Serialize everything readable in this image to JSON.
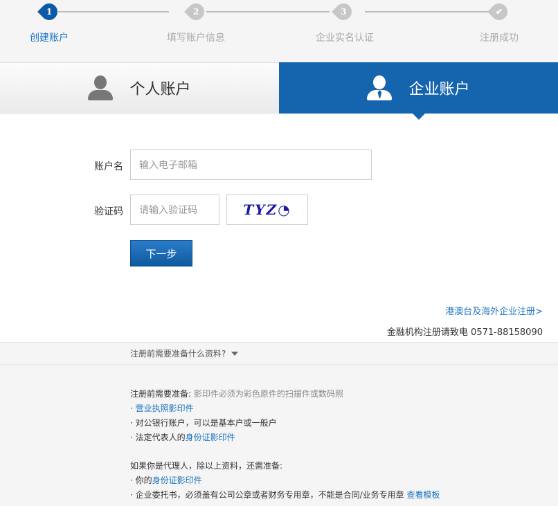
{
  "steps": [
    {
      "num": "1",
      "label": "创建账户",
      "state": "active"
    },
    {
      "num": "2",
      "label": "填写账户信息",
      "state": "inactive"
    },
    {
      "num": "3",
      "label": "企业实名认证",
      "state": "inactive"
    },
    {
      "num": "✔",
      "label": "注册成功",
      "state": "inactive"
    }
  ],
  "tabs": {
    "personal": "个人账户",
    "company": "企业账户"
  },
  "form": {
    "account_label": "账户名",
    "account_placeholder": "输入电子邮箱",
    "captcha_label": "验证码",
    "captcha_placeholder": "请输入验证码",
    "captcha_text": "TYZ◔",
    "next_button": "下一步"
  },
  "links": {
    "hk_register": "港澳台及海外企业注册>",
    "contact_prefix": "金融机构注册请致电",
    "contact_phone": "0571-88158090"
  },
  "info": {
    "toggle": "注册前需要准备什么资料?",
    "prep_title": "注册前需要准备:",
    "prep_note": "影印件必须为彩色原件的扫描件或数码照",
    "item_license": "营业执照影印件",
    "item_bank": "对公银行账户，可以是基本户或一般户",
    "item_legal_prefix": "法定代表人的",
    "item_legal_link": "身份证影印件",
    "agent_title": "如果你是代理人，除以上资料，还需准备:",
    "agent_id_prefix": "你的",
    "agent_id_link": "身份证影印件",
    "agent_letter": "企业委托书，必须盖有公司公章或者财务专用章，不能是合同/业务专用章",
    "agent_template_link": "查看模板"
  },
  "colors": {
    "accent": "#1464ae",
    "link": "#1a73c2"
  }
}
